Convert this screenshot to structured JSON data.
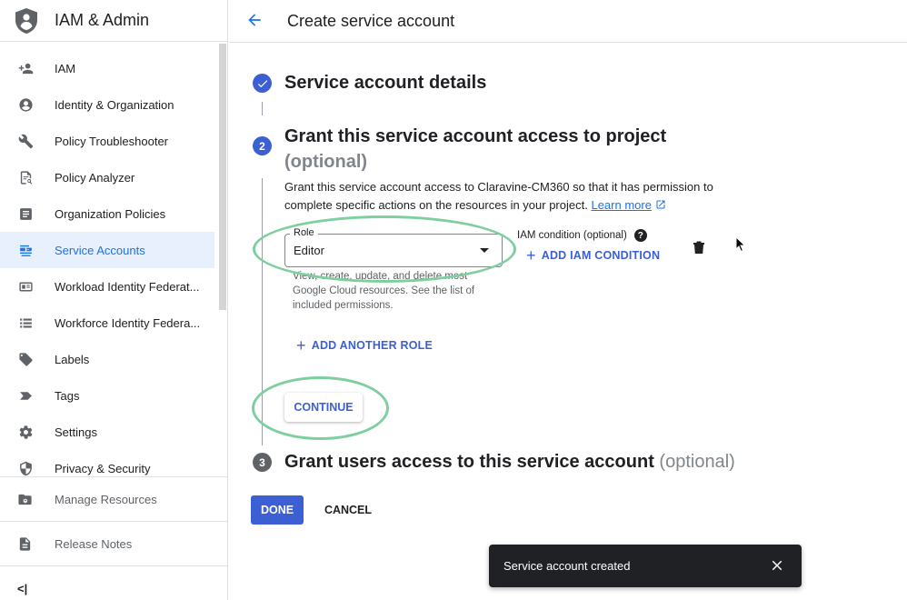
{
  "app": {
    "title": "IAM & Admin"
  },
  "header": {
    "title": "Create service account"
  },
  "sidebar": {
    "items": [
      {
        "label": "IAM",
        "icon": "person-add-icon"
      },
      {
        "label": "Identity & Organization",
        "icon": "account-circle-icon"
      },
      {
        "label": "Policy Troubleshooter",
        "icon": "wrench-icon"
      },
      {
        "label": "Policy Analyzer",
        "icon": "policy-analyzer-icon"
      },
      {
        "label": "Organization Policies",
        "icon": "article-icon"
      },
      {
        "label": "Service Accounts",
        "icon": "service-account-icon",
        "active": true
      },
      {
        "label": "Workload Identity Federat...",
        "icon": "badge-icon"
      },
      {
        "label": "Workforce Identity Federa...",
        "icon": "list-icon"
      },
      {
        "label": "Labels",
        "icon": "label-icon"
      },
      {
        "label": "Tags",
        "icon": "tag-icon"
      },
      {
        "label": "Settings",
        "icon": "gear-icon"
      },
      {
        "label": "Privacy & Security",
        "icon": "shield-icon"
      }
    ],
    "footer": [
      {
        "label": "Manage Resources",
        "icon": "manage-resources-icon"
      },
      {
        "label": "Release Notes",
        "icon": "release-notes-icon"
      }
    ],
    "collapse_label": "<|"
  },
  "steps": {
    "step1": {
      "title": "Service account details"
    },
    "step2": {
      "number": "2",
      "title": "Grant this service account access to project",
      "optional": "(optional)",
      "description": "Grant this service account access to Claravine-CM360 so that it has permission to complete specific actions on the resources in your project.",
      "learn_more": "Learn more"
    },
    "step3": {
      "number": "3",
      "title": "Grant users access to this service account",
      "optional": "(optional)"
    }
  },
  "role": {
    "label": "Role",
    "value": "Editor",
    "help": "View, create, update, and delete most Google Cloud resources. See the list of included permissions."
  },
  "iam_condition": {
    "label": "IAM condition (optional)",
    "add_label": "ADD IAM CONDITION"
  },
  "buttons": {
    "add_another_role": "ADD ANOTHER ROLE",
    "continue": "CONTINUE",
    "done": "DONE",
    "cancel": "CANCEL"
  },
  "snackbar": {
    "message": "Service account created"
  },
  "colors": {
    "accent": "#3c5fd4",
    "highlight": "#7fcf9e",
    "active_bg": "#e8f0fe"
  }
}
